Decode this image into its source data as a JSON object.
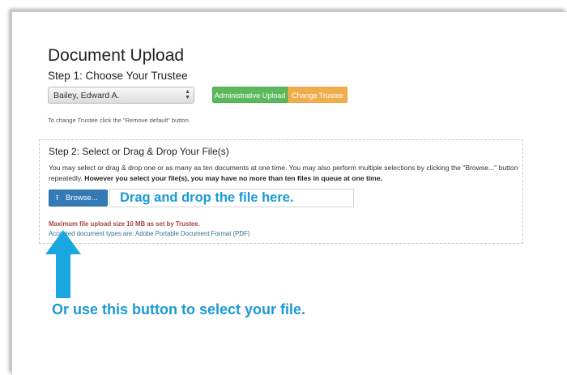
{
  "page": {
    "title": "Document Upload",
    "step1_title": "Step 1: Choose Your Trustee",
    "trustee_select": {
      "value": "Bailey, Edward A."
    },
    "admin_upload_label": "Administrative Upload",
    "change_trustee_label": "Change Trustee",
    "hint": "To change Trustee click the \"Remove default\" button."
  },
  "step2": {
    "title": "Step 2: Select or Drag & Drop Your File(s)",
    "desc_plain": "You may select or drag & drop one or as many as ten documents at one time. You may also perform multiple selections by clicking the \"Browse...\" button repeatedly. ",
    "desc_bold": "However you select your file(s), you may have no more than ten files in queue at one time.",
    "browse_label": "Browse...",
    "max_size": "Maximum file upload size 10 MB as set by Trustee.",
    "accepted": "Accepted document types are: Adobe Portable Document Format (PDF)"
  },
  "annotations": {
    "drop_callout": "Drag and drop the file here.",
    "button_callout": "Or use this button to select your file.",
    "accent_color": "#1a9ad6"
  },
  "icons": {
    "upload": "upload-icon",
    "select_arrows": "select-arrows-icon"
  }
}
